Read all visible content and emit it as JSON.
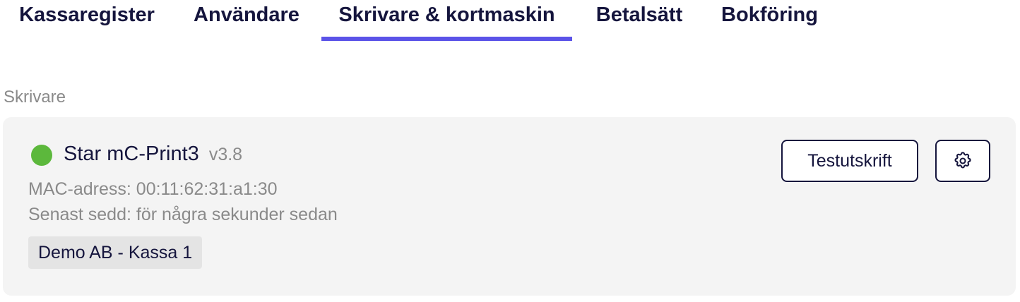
{
  "tabs": [
    {
      "label": "Kassaregister",
      "active": false
    },
    {
      "label": "Användare",
      "active": false
    },
    {
      "label": "Skrivare & kortmaskin",
      "active": true
    },
    {
      "label": "Betalsätt",
      "active": false
    },
    {
      "label": "Bokföring",
      "active": false
    }
  ],
  "section": {
    "title": "Skrivare"
  },
  "printer": {
    "name": "Star mC-Print3",
    "version": "v3.8",
    "mac_line": "MAC-adress: 00:11:62:31:a1:30",
    "last_seen_line": "Senast sedd: för några sekunder sedan",
    "register_tag": "Demo AB - Kassa 1",
    "status_icon": "status-online-dot",
    "status_color": "#5cb83c",
    "test_print_label": "Testutskrift",
    "settings_icon": "gear-icon"
  },
  "colors": {
    "accent": "#5b53e8",
    "text_primary": "#15153d",
    "text_muted": "#8a8a8a",
    "card_bg": "#f4f4f4",
    "tag_bg": "#e4e4e4"
  }
}
